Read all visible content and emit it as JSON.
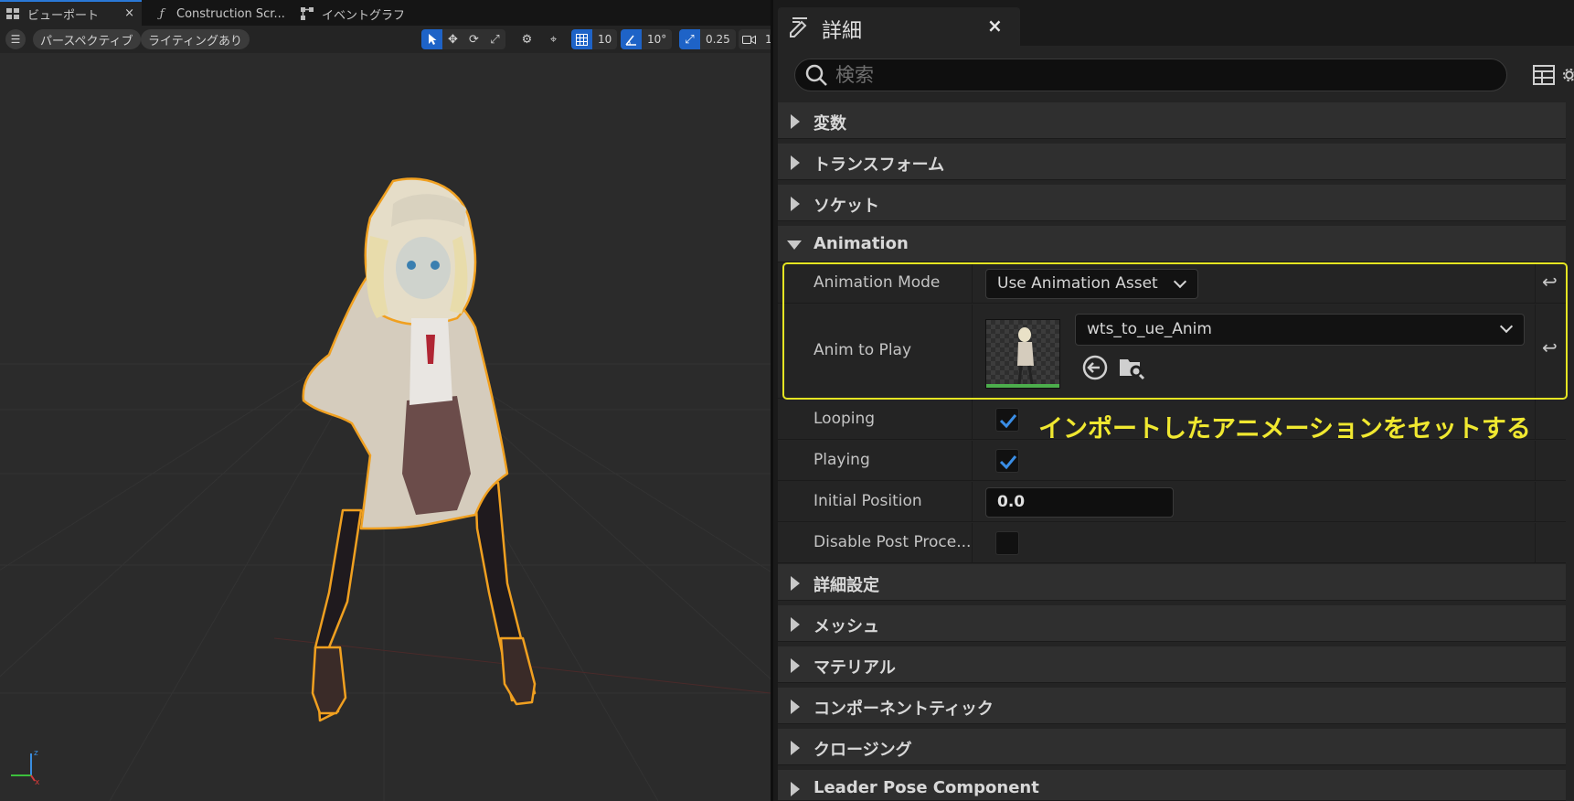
{
  "viewport": {
    "tabs": [
      {
        "label": "ビューポート",
        "icon": "viewport-icon",
        "close": "×"
      },
      {
        "label": "Construction Scr...",
        "icon": "function-icon"
      },
      {
        "label": "イベントグラフ",
        "icon": "graph-icon"
      }
    ],
    "toolbar": {
      "perspective": "パースペクティブ",
      "lighting": "ライティングあり",
      "grid_snap": "10",
      "rotation_snap": "10°",
      "scale_snap": "0.25",
      "camera_speed": "1"
    }
  },
  "details": {
    "title": "詳細",
    "close": "×",
    "search_placeholder": "検索",
    "sections_top": [
      "変数",
      "トランスフォーム",
      "ソケット"
    ],
    "animation": {
      "header": "Animation",
      "animation_mode": {
        "label": "Animation Mode",
        "value": "Use Animation Asset"
      },
      "anim_to_play": {
        "label": "Anim to Play",
        "value": "wts_to_ue_Anim"
      },
      "looping": {
        "label": "Looping",
        "checked": true
      },
      "playing": {
        "label": "Playing",
        "checked": true
      },
      "initial_position": {
        "label": "Initial Position",
        "value": "0.0"
      },
      "disable_post_process": {
        "label": "Disable Post Proce...",
        "checked": false
      }
    },
    "sections_bottom": [
      "詳細設定",
      "メッシュ",
      "マテリアル",
      "コンポーネントティック",
      "クロージング",
      "Leader Pose Component"
    ],
    "annotation": "インポートしたアニメーションをセットする"
  },
  "colors": {
    "accent_blue": "#1e63c7",
    "highlight_yellow": "#e5e522",
    "annotation_yellow": "#f0e830",
    "selection_orange": "#f0a020"
  }
}
